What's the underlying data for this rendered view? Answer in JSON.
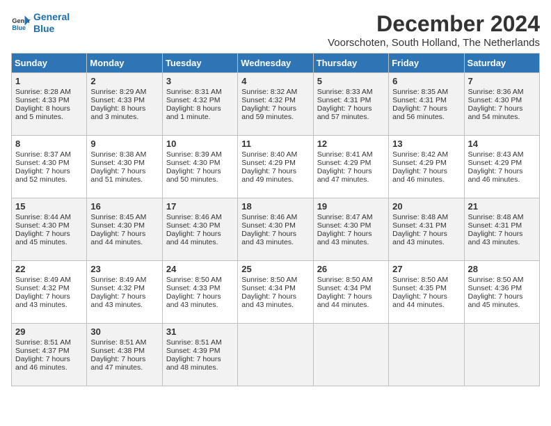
{
  "logo": {
    "line1": "General",
    "line2": "Blue"
  },
  "title": "December 2024",
  "location": "Voorschoten, South Holland, The Netherlands",
  "days_of_week": [
    "Sunday",
    "Monday",
    "Tuesday",
    "Wednesday",
    "Thursday",
    "Friday",
    "Saturday"
  ],
  "weeks": [
    [
      {
        "day": "1",
        "sunrise": "Sunrise: 8:28 AM",
        "sunset": "Sunset: 4:33 PM",
        "daylight": "Daylight: 8 hours and 5 minutes."
      },
      {
        "day": "2",
        "sunrise": "Sunrise: 8:29 AM",
        "sunset": "Sunset: 4:33 PM",
        "daylight": "Daylight: 8 hours and 3 minutes."
      },
      {
        "day": "3",
        "sunrise": "Sunrise: 8:31 AM",
        "sunset": "Sunset: 4:32 PM",
        "daylight": "Daylight: 8 hours and 1 minute."
      },
      {
        "day": "4",
        "sunrise": "Sunrise: 8:32 AM",
        "sunset": "Sunset: 4:32 PM",
        "daylight": "Daylight: 7 hours and 59 minutes."
      },
      {
        "day": "5",
        "sunrise": "Sunrise: 8:33 AM",
        "sunset": "Sunset: 4:31 PM",
        "daylight": "Daylight: 7 hours and 57 minutes."
      },
      {
        "day": "6",
        "sunrise": "Sunrise: 8:35 AM",
        "sunset": "Sunset: 4:31 PM",
        "daylight": "Daylight: 7 hours and 56 minutes."
      },
      {
        "day": "7",
        "sunrise": "Sunrise: 8:36 AM",
        "sunset": "Sunset: 4:30 PM",
        "daylight": "Daylight: 7 hours and 54 minutes."
      }
    ],
    [
      {
        "day": "8",
        "sunrise": "Sunrise: 8:37 AM",
        "sunset": "Sunset: 4:30 PM",
        "daylight": "Daylight: 7 hours and 52 minutes."
      },
      {
        "day": "9",
        "sunrise": "Sunrise: 8:38 AM",
        "sunset": "Sunset: 4:30 PM",
        "daylight": "Daylight: 7 hours and 51 minutes."
      },
      {
        "day": "10",
        "sunrise": "Sunrise: 8:39 AM",
        "sunset": "Sunset: 4:30 PM",
        "daylight": "Daylight: 7 hours and 50 minutes."
      },
      {
        "day": "11",
        "sunrise": "Sunrise: 8:40 AM",
        "sunset": "Sunset: 4:29 PM",
        "daylight": "Daylight: 7 hours and 49 minutes."
      },
      {
        "day": "12",
        "sunrise": "Sunrise: 8:41 AM",
        "sunset": "Sunset: 4:29 PM",
        "daylight": "Daylight: 7 hours and 47 minutes."
      },
      {
        "day": "13",
        "sunrise": "Sunrise: 8:42 AM",
        "sunset": "Sunset: 4:29 PM",
        "daylight": "Daylight: 7 hours and 46 minutes."
      },
      {
        "day": "14",
        "sunrise": "Sunrise: 8:43 AM",
        "sunset": "Sunset: 4:29 PM",
        "daylight": "Daylight: 7 hours and 46 minutes."
      }
    ],
    [
      {
        "day": "15",
        "sunrise": "Sunrise: 8:44 AM",
        "sunset": "Sunset: 4:30 PM",
        "daylight": "Daylight: 7 hours and 45 minutes."
      },
      {
        "day": "16",
        "sunrise": "Sunrise: 8:45 AM",
        "sunset": "Sunset: 4:30 PM",
        "daylight": "Daylight: 7 hours and 44 minutes."
      },
      {
        "day": "17",
        "sunrise": "Sunrise: 8:46 AM",
        "sunset": "Sunset: 4:30 PM",
        "daylight": "Daylight: 7 hours and 44 minutes."
      },
      {
        "day": "18",
        "sunrise": "Sunrise: 8:46 AM",
        "sunset": "Sunset: 4:30 PM",
        "daylight": "Daylight: 7 hours and 43 minutes."
      },
      {
        "day": "19",
        "sunrise": "Sunrise: 8:47 AM",
        "sunset": "Sunset: 4:30 PM",
        "daylight": "Daylight: 7 hours and 43 minutes."
      },
      {
        "day": "20",
        "sunrise": "Sunrise: 8:48 AM",
        "sunset": "Sunset: 4:31 PM",
        "daylight": "Daylight: 7 hours and 43 minutes."
      },
      {
        "day": "21",
        "sunrise": "Sunrise: 8:48 AM",
        "sunset": "Sunset: 4:31 PM",
        "daylight": "Daylight: 7 hours and 43 minutes."
      }
    ],
    [
      {
        "day": "22",
        "sunrise": "Sunrise: 8:49 AM",
        "sunset": "Sunset: 4:32 PM",
        "daylight": "Daylight: 7 hours and 43 minutes."
      },
      {
        "day": "23",
        "sunrise": "Sunrise: 8:49 AM",
        "sunset": "Sunset: 4:32 PM",
        "daylight": "Daylight: 7 hours and 43 minutes."
      },
      {
        "day": "24",
        "sunrise": "Sunrise: 8:50 AM",
        "sunset": "Sunset: 4:33 PM",
        "daylight": "Daylight: 7 hours and 43 minutes."
      },
      {
        "day": "25",
        "sunrise": "Sunrise: 8:50 AM",
        "sunset": "Sunset: 4:34 PM",
        "daylight": "Daylight: 7 hours and 43 minutes."
      },
      {
        "day": "26",
        "sunrise": "Sunrise: 8:50 AM",
        "sunset": "Sunset: 4:34 PM",
        "daylight": "Daylight: 7 hours and 44 minutes."
      },
      {
        "day": "27",
        "sunrise": "Sunrise: 8:50 AM",
        "sunset": "Sunset: 4:35 PM",
        "daylight": "Daylight: 7 hours and 44 minutes."
      },
      {
        "day": "28",
        "sunrise": "Sunrise: 8:50 AM",
        "sunset": "Sunset: 4:36 PM",
        "daylight": "Daylight: 7 hours and 45 minutes."
      }
    ],
    [
      {
        "day": "29",
        "sunrise": "Sunrise: 8:51 AM",
        "sunset": "Sunset: 4:37 PM",
        "daylight": "Daylight: 7 hours and 46 minutes."
      },
      {
        "day": "30",
        "sunrise": "Sunrise: 8:51 AM",
        "sunset": "Sunset: 4:38 PM",
        "daylight": "Daylight: 7 hours and 47 minutes."
      },
      {
        "day": "31",
        "sunrise": "Sunrise: 8:51 AM",
        "sunset": "Sunset: 4:39 PM",
        "daylight": "Daylight: 7 hours and 48 minutes."
      },
      null,
      null,
      null,
      null
    ]
  ]
}
